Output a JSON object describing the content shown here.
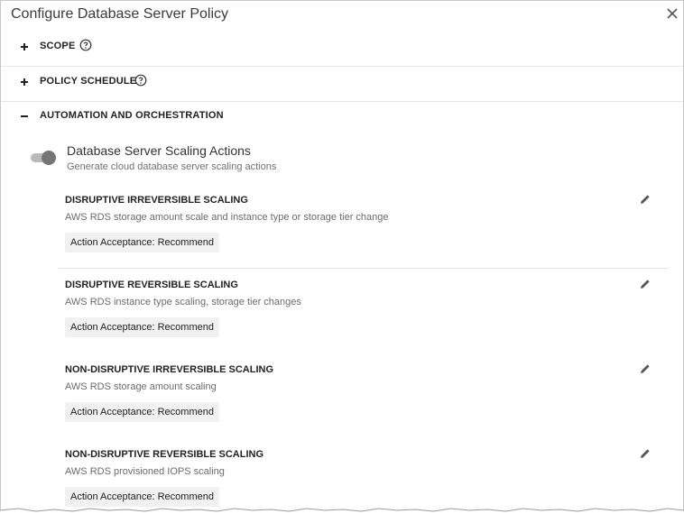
{
  "dialog": {
    "title": "Configure Database Server Policy",
    "close_icon": "close-icon"
  },
  "sections": [
    {
      "label": "SCOPE",
      "state": "collapsed",
      "has_help": true
    },
    {
      "label": "POLICY SCHEDULE",
      "state": "collapsed",
      "has_help": true
    },
    {
      "label": "AUTOMATION AND ORCHESTRATION",
      "state": "expanded",
      "has_help": false
    }
  ],
  "automation": {
    "toggle_state": "off",
    "title": "Database Server Scaling Actions",
    "subtitle": "Generate cloud database server scaling actions",
    "items": [
      {
        "title": "DISRUPTIVE IRREVERSIBLE SCALING",
        "description": "AWS RDS storage amount scale and instance type or storage tier change",
        "badge": "Action Acceptance: Recommend"
      },
      {
        "title": "DISRUPTIVE REVERSIBLE SCALING",
        "description": "AWS RDS instance type scaling, storage tier changes",
        "badge": "Action Acceptance: Recommend"
      },
      {
        "title": "NON-DISRUPTIVE IRREVERSIBLE SCALING",
        "description": "AWS RDS storage amount scaling",
        "badge": "Action Acceptance: Recommend"
      },
      {
        "title": "NON-DISRUPTIVE REVERSIBLE SCALING",
        "description": "AWS RDS provisioned IOPS scaling",
        "badge": "Action Acceptance: Recommend"
      }
    ]
  },
  "colors": {
    "text_primary": "#222222",
    "text_secondary": "#6b6b6b",
    "badge_bg": "#f1f1f1",
    "toggle_knob": "#757575",
    "toggle_track": "#b9b9b9"
  }
}
